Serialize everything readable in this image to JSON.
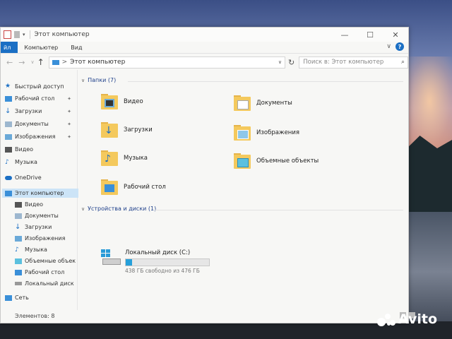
{
  "window": {
    "title": "Этот компьютер",
    "minimize": "—",
    "maximize": "☐",
    "close": "✕"
  },
  "ribbon": {
    "file_tab": "йл",
    "tabs": [
      "Компьютер",
      "Вид"
    ],
    "collapse": "∨",
    "help": "?"
  },
  "address": {
    "back": "←",
    "forward": "→",
    "recent": "∨",
    "up": "↑",
    "separator": ">",
    "path": "Этот компьютер",
    "refresh": "↻",
    "search_placeholder": "Поиск в: Этот компьютер",
    "search_icon": "⌕"
  },
  "sidebar": {
    "items": [
      {
        "label": "Быстрый доступ",
        "icon": "star-icon"
      },
      {
        "label": "Рабочий стол",
        "icon": "desktop-icon",
        "pinned": true
      },
      {
        "label": "Загрузки",
        "icon": "download-icon",
        "pinned": true
      },
      {
        "label": "Документы",
        "icon": "documents-icon",
        "pinned": true
      },
      {
        "label": "Изображения",
        "icon": "pictures-icon",
        "pinned": true
      },
      {
        "label": "Видео",
        "icon": "video-icon"
      },
      {
        "label": "Музыка",
        "icon": "music-icon"
      },
      {
        "label": "OneDrive",
        "icon": "cloud-icon"
      },
      {
        "label": "Этот компьютер",
        "icon": "computer-icon",
        "selected": true
      },
      {
        "label": "Видео",
        "icon": "video-icon"
      },
      {
        "label": "Документы",
        "icon": "documents-icon"
      },
      {
        "label": "Загрузки",
        "icon": "download-icon"
      },
      {
        "label": "Изображения",
        "icon": "pictures-icon"
      },
      {
        "label": "Музыка",
        "icon": "music-icon"
      },
      {
        "label": "Объемные объекты",
        "icon": "3d-objects-icon"
      },
      {
        "label": "Рабочий стол",
        "icon": "desktop-icon"
      },
      {
        "label": "Локальный диск (C",
        "icon": "drive-icon"
      },
      {
        "label": "Сеть",
        "icon": "network-icon"
      }
    ],
    "pin_glyph": "✦"
  },
  "content": {
    "folders_header": "Папки",
    "folders_count": "(7)",
    "folders": [
      {
        "label": "Видео",
        "icon": "video-folder-icon"
      },
      {
        "label": "Документы",
        "icon": "documents-folder-icon"
      },
      {
        "label": "Загрузки",
        "icon": "downloads-folder-icon"
      },
      {
        "label": "Изображения",
        "icon": "pictures-folder-icon"
      },
      {
        "label": "Музыка",
        "icon": "music-folder-icon"
      },
      {
        "label": "Объемные объекты",
        "icon": "3d-objects-folder-icon"
      },
      {
        "label": "Рабочий стол",
        "icon": "desktop-folder-icon"
      }
    ],
    "drives_header": "Устройства и диски",
    "drives_count": "(1)",
    "drive": {
      "name": "Локальный диск (C:)",
      "free_text": "438 ГБ свободно из 476 ГБ",
      "used_fraction": 0.08
    },
    "chevron": "∨"
  },
  "status": {
    "items_text": "Элементов: 8"
  },
  "watermark": {
    "text": "Avito"
  },
  "colors": {
    "accent": "#1b6fc4",
    "folder": "#f4c95d",
    "drive_bar": "#26a0da",
    "selection": "#cce4f7"
  }
}
